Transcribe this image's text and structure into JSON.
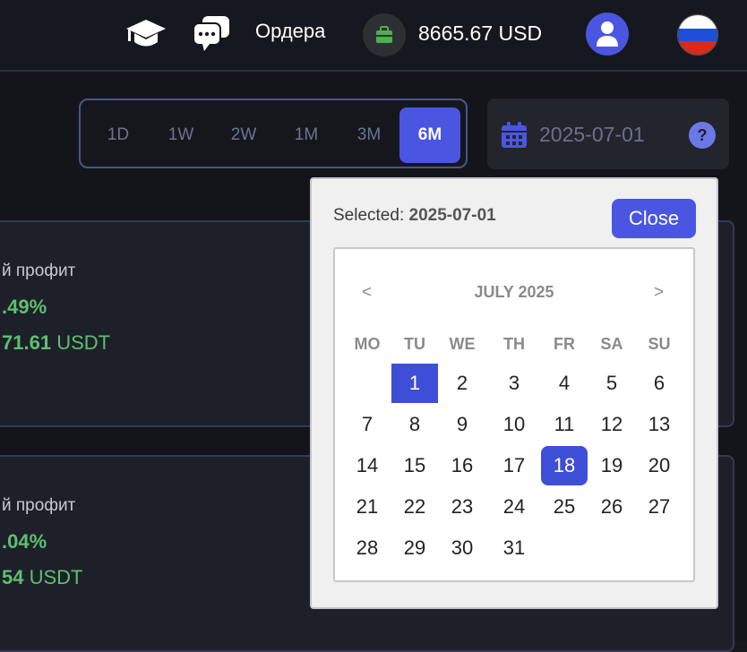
{
  "header": {
    "orders_label": "Ордера",
    "balance": "8665.67 USD",
    "icons": [
      "graduation-cap-icon",
      "chat-icon",
      "wallet-icon",
      "user-icon",
      "russia-flag-icon"
    ],
    "flag_colors": [
      "#ffffff",
      "#1f4fd6",
      "#d52b1e"
    ]
  },
  "period": {
    "options": [
      "1D",
      "1W",
      "2W",
      "1M",
      "3M",
      "6M"
    ],
    "active": "6M",
    "accent": "#4a56e2"
  },
  "date_picker": {
    "value": "2025-07-01",
    "help": "?"
  },
  "cards": [
    {
      "label": "й профит",
      "pct": ".49%",
      "usdt_num": "71.61",
      "usdt_unit": "USDT"
    },
    {
      "label": "й профит",
      "pct": ".04%",
      "usdt_num": "54",
      "usdt_unit": "USDT"
    }
  ],
  "calendar_popup": {
    "selected_prefix": "Selected:",
    "selected_value": "2025-07-01",
    "close_label": "Close",
    "month_label": "JULY 2025",
    "prev": "<",
    "next": ">",
    "weekdays": [
      "MO",
      "TU",
      "WE",
      "TH",
      "FR",
      "SA",
      "SU"
    ],
    "first_weekday_index": 1,
    "days_in_month": 31,
    "selected_day": 1,
    "today_day": 18
  }
}
